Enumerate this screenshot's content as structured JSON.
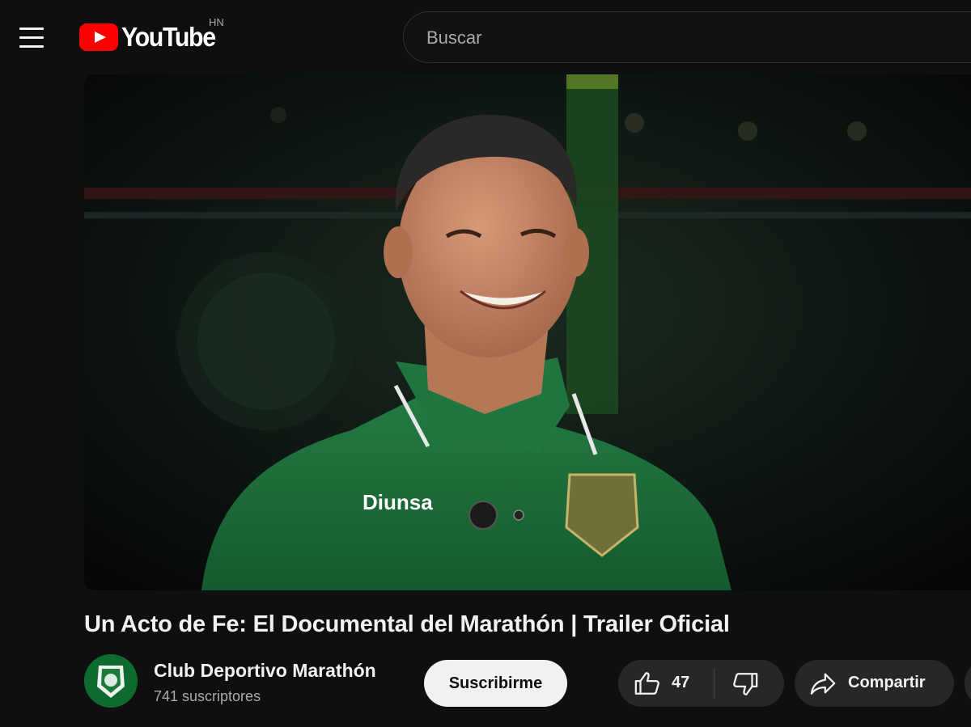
{
  "header": {
    "logo_text": "YouTube",
    "country_code": "HN",
    "search_placeholder": "Buscar"
  },
  "video": {
    "title": "Un Acto de Fe: El Documental del Marathón | Trailer Oficial",
    "jersey_sponsor": "Diunsa"
  },
  "channel": {
    "name": "Club Deportivo Marathón",
    "subscribers": "741 suscriptores",
    "subscribe_label": "Suscribirme"
  },
  "actions": {
    "like_count": "47",
    "share_label": "Compartir"
  },
  "colors": {
    "background": "#0f0f0f",
    "brand_red": "#ff0000",
    "button_bg": "#272727",
    "jersey_green": "#1e6b3a"
  },
  "icons": [
    "menu-icon",
    "youtube-play-icon",
    "thumbs-up-icon",
    "thumbs-down-icon",
    "share-icon"
  ]
}
